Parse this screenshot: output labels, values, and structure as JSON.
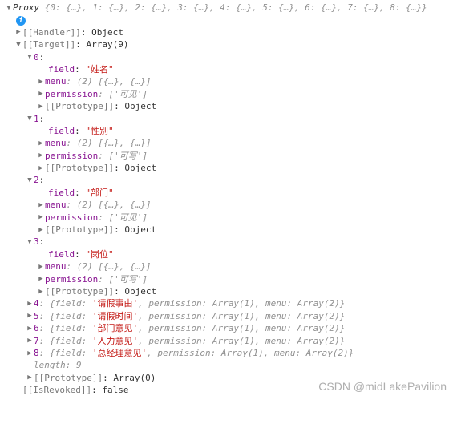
{
  "header": {
    "proxy_label": "Proxy ",
    "proxy_preview": "{0: {…}, 1: {…}, 2: {…}, 3: {…}, 4: {…}, 5: {…}, 6: {…}, 7: {…}, 8: {…}}"
  },
  "info_icon": "i",
  "target": {
    "handler_label": "[[Handler]]",
    "handler_suffix": ": Object",
    "target_label": "[[Target]]",
    "target_suffix": ": Array(9)",
    "items": [
      {
        "index": "0",
        "field_key": "field",
        "field_value": "\"姓名\"",
        "menu_key": "menu",
        "menu_preview": ": (2) [{…}, {…}]",
        "perm_key": "permission",
        "perm_preview": ": ['可见']",
        "proto_key": "[[Prototype]]",
        "proto_val": ": Object"
      },
      {
        "index": "1",
        "field_key": "field",
        "field_value": "\"性别\"",
        "menu_key": "menu",
        "menu_preview": ": (2) [{…}, {…}]",
        "perm_key": "permission",
        "perm_preview": ": ['可写']",
        "proto_key": "[[Prototype]]",
        "proto_val": ": Object"
      },
      {
        "index": "2",
        "field_key": "field",
        "field_value": "\"部门\"",
        "menu_key": "menu",
        "menu_preview": ": (2) [{…}, {…}]",
        "perm_key": "permission",
        "perm_preview": ": ['可见']",
        "proto_key": "[[Prototype]]",
        "proto_val": ": Object"
      },
      {
        "index": "3",
        "field_key": "field",
        "field_value": "\"岗位\"",
        "menu_key": "menu",
        "menu_preview": ": (2) [{…}, {…}]",
        "perm_key": "permission",
        "perm_preview": ": ['可写']",
        "proto_key": "[[Prototype]]",
        "proto_val": ": Object"
      }
    ],
    "collapsed": [
      {
        "idx": "4",
        "field": "'请假事由'"
      },
      {
        "idx": "5",
        "field": "'请假时间'"
      },
      {
        "idx": "6",
        "field": "'部门意见'"
      },
      {
        "idx": "7",
        "field": "'人力意见'"
      },
      {
        "idx": "8",
        "field": "'总经理意见'"
      }
    ],
    "collapsed_prefix": ": {field: ",
    "collapsed_suffix": ", permission: Array(1), menu: Array(2)}",
    "length_key": "length",
    "length_val": ": 9",
    "proto_key": "[[Prototype]]",
    "proto_val": ": Array(0)",
    "revoked_key": "[[IsRevoked]]",
    "revoked_val": ": false"
  },
  "watermark": "CSDN @midLakePavilion"
}
